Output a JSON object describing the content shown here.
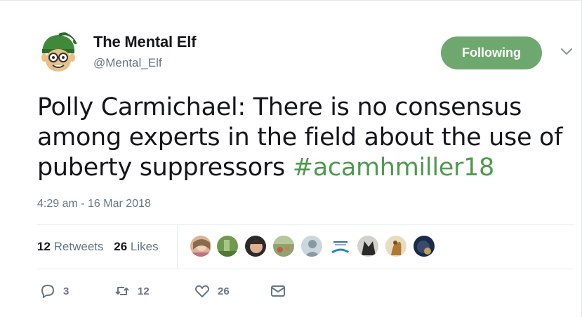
{
  "author": {
    "name": "The Mental Elf",
    "handle": "@Mental_Elf",
    "avatar_icon": "elf-avatar-icon"
  },
  "follow_button": {
    "label": "Following",
    "color": "#6fa86e"
  },
  "tweet": {
    "text_plain": "Polly Carmichael: There is no consensus among experts in the field about the use of puberty suppressors ",
    "hashtag": "#acamhmiller18",
    "hashtag_color": "#4f9a4f"
  },
  "timestamp": "4:29 am - 16 Mar 2018",
  "stats": {
    "retweets_count": "12",
    "retweets_label": "Retweets",
    "likes_count": "26",
    "likes_label": "Likes"
  },
  "liker_avatars": [
    "avatar-1",
    "avatar-2",
    "avatar-3",
    "avatar-4",
    "avatar-5",
    "avatar-6",
    "avatar-7",
    "avatar-8",
    "avatar-9"
  ],
  "actions": {
    "reply_count": "3",
    "retweet_count": "12",
    "like_count": "26"
  }
}
